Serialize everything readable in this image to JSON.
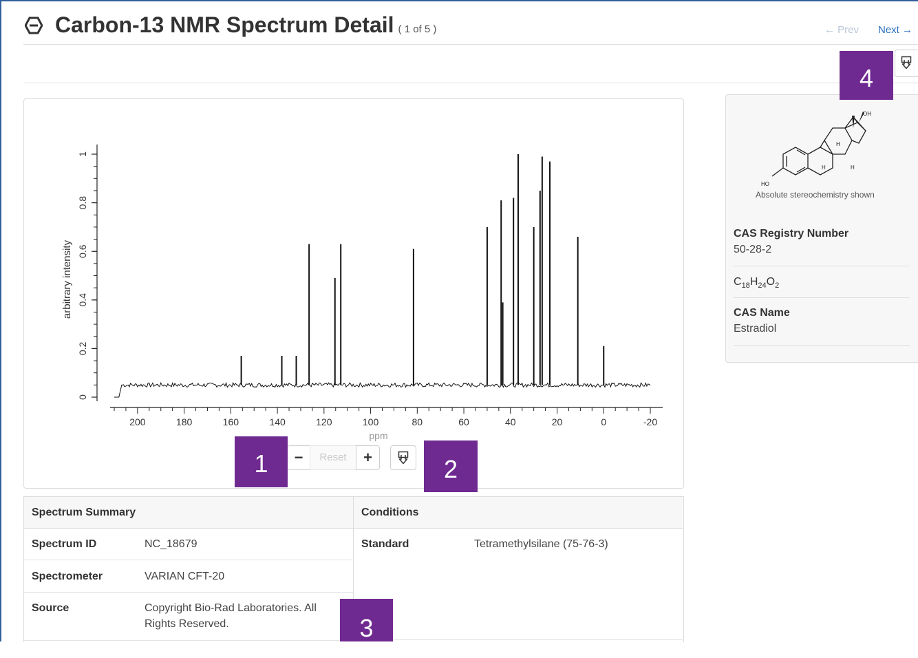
{
  "header": {
    "title": "Carbon-13 NMR Spectrum Detail",
    "count": "( 1 of 5 )",
    "prev_label": "Prev",
    "next_label": "Next"
  },
  "chart_controls": {
    "minus_label": "−",
    "reset_label": "Reset",
    "plus_label": "+"
  },
  "badges": [
    "1",
    "2",
    "3",
    "4"
  ],
  "chart_data": {
    "type": "line",
    "xlabel": "ppm",
    "ylabel": "arbitrary intensity",
    "xlim": [
      210,
      -20
    ],
    "ylim": [
      0,
      1
    ],
    "x_axis_reversed": true,
    "xticks": [
      "200",
      "180",
      "160",
      "140",
      "120",
      "100",
      "80",
      "60",
      "40",
      "20",
      "0",
      "-20"
    ],
    "yticks": [
      "0",
      "0.2",
      "0.4",
      "0.6",
      "0.8",
      "1"
    ],
    "peaks": [
      {
        "x": 155.5,
        "y": 0.17
      },
      {
        "x": 138.1,
        "y": 0.17
      },
      {
        "x": 131.9,
        "y": 0.17
      },
      {
        "x": 126.4,
        "y": 0.63
      },
      {
        "x": 115.3,
        "y": 0.49
      },
      {
        "x": 112.8,
        "y": 0.63
      },
      {
        "x": 81.6,
        "y": 0.61
      },
      {
        "x": 50.0,
        "y": 0.7
      },
      {
        "x": 44.0,
        "y": 0.81
      },
      {
        "x": 43.3,
        "y": 0.39
      },
      {
        "x": 38.7,
        "y": 0.82
      },
      {
        "x": 36.7,
        "y": 1.0
      },
      {
        "x": 30.0,
        "y": 0.7
      },
      {
        "x": 27.3,
        "y": 0.85
      },
      {
        "x": 26.4,
        "y": 0.99
      },
      {
        "x": 23.1,
        "y": 0.97
      },
      {
        "x": 11.1,
        "y": 0.66
      },
      {
        "x": 0.0,
        "y": 0.21
      }
    ],
    "baseline": 0.05,
    "grid": false
  },
  "summary": {
    "header": "Spectrum Summary",
    "rows": [
      {
        "label": "Spectrum ID",
        "value": "NC_18679"
      },
      {
        "label": "Spectrometer",
        "value": "VARIAN CFT-20"
      },
      {
        "label": "Source",
        "value_line1": "Copyright Bio-Rad Laboratories. All",
        "value_line2": "Rights Reserved."
      }
    ]
  },
  "conditions": {
    "header": "Conditions",
    "rows": [
      {
        "label": "Standard",
        "value": "Tetramethylsilane (75-76-3)"
      }
    ]
  },
  "compound": {
    "structure_caption": "Absolute stereochemistry shown",
    "structure_labels": {
      "oh": "OH",
      "ho": "HO",
      "h": "H"
    },
    "cas_number_label": "CAS Registry Number",
    "cas_number": "50-28-2",
    "formula_parts": {
      "c": "C",
      "c_n": "18",
      "h": "H",
      "h_n": "24",
      "o": "O",
      "o_n": "2"
    },
    "cas_name_label": "CAS Name",
    "cas_name": "Estradiol"
  },
  "colors": {
    "badge": "#6f2a91",
    "link": "#2a6fbf",
    "frame": "#2f5f99"
  }
}
